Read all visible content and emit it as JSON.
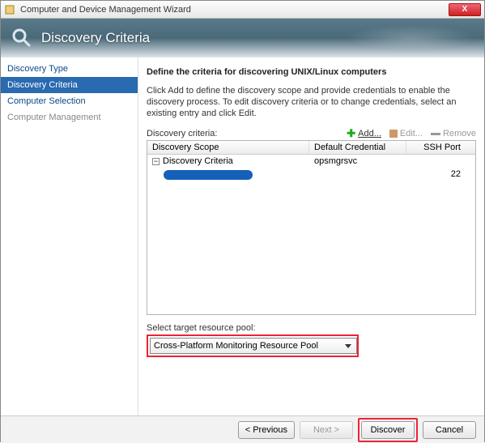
{
  "window": {
    "title": "Computer and Device Management Wizard",
    "close": "X"
  },
  "header": {
    "title": "Discovery Criteria"
  },
  "sidebar": {
    "items": [
      {
        "label": "Discovery Type"
      },
      {
        "label": "Discovery Criteria"
      },
      {
        "label": "Computer Selection"
      },
      {
        "label": "Computer Management"
      }
    ]
  },
  "main": {
    "heading": "Define the criteria for discovering UNIX/Linux computers",
    "description": "Click Add to define the discovery scope and provide credentials to enable the discovery process. To edit discovery criteria or to change credentials, select an existing entry and click Edit.",
    "criteria_label": "Discovery criteria:",
    "toolbar": {
      "add": "Add...",
      "edit": "Edit...",
      "remove": "Remove"
    },
    "grid": {
      "cols": {
        "scope": "Discovery Scope",
        "cred": "Default Credential",
        "port": "SSH Port"
      },
      "rows": [
        {
          "scope": "Discovery Criteria",
          "cred": "opsmgrsvc",
          "port": "22"
        }
      ]
    },
    "pool_label": "Select target resource pool:",
    "pool_value": "Cross-Platform Monitoring Resource Pool"
  },
  "footer": {
    "previous": "< Previous",
    "next": "Next >",
    "discover": "Discover",
    "cancel": "Cancel"
  }
}
